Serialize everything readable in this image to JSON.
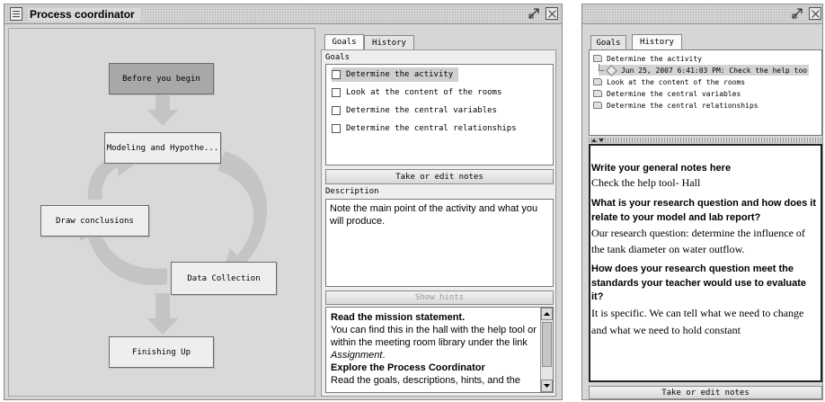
{
  "process_window": {
    "title": "Process coordinator",
    "flow": {
      "before": "Before you begin",
      "modeling": "Modeling and Hypothe...",
      "draw": "Draw conclusions",
      "data": "Data Collection",
      "finishing": "Finishing Up"
    },
    "tabs": {
      "goals": "Goals",
      "history": "History"
    },
    "goals_label": "Goals",
    "goals": [
      "Determine the activity",
      "Look at the content of the rooms",
      "Determine the central variables",
      "Determine the central relationships"
    ],
    "notes_button": "Take or edit notes",
    "description_label": "Description",
    "description_text": "Note the main point of the activity and what you will produce.",
    "hints_button": "Show hints",
    "hints": {
      "h1": "Read the mission statement.",
      "p1a": "You can find this in the hall with the help tool or within the meeting room library under the link ",
      "p1link": "Assignment",
      "p1end": ".",
      "h2": "Explore the Process Coordinator",
      "p2": "Read the goals, descriptions, hints, and the"
    }
  },
  "history_window": {
    "tabs": {
      "goals": "Goals",
      "history": "History"
    },
    "tree": {
      "root": "Determine the activity",
      "child": "Jun 25, 2007 6:41:03 PM: Check the help too",
      "items": [
        "Look at the content of the rooms",
        "Determine the central variables",
        "Determine the central relationships"
      ]
    },
    "notes": {
      "h1": "Write your general notes here",
      "p1": "Check the help tool- Hall",
      "h2": "What is your research question and how does it relate to your model and lab report?",
      "p2": "Our research question: determine the influence of the tank diameter on water outflow.",
      "h3": "How does your research question meet the standards your teacher would use to evaluate it?",
      "p3": "It is specific. We can tell what we need to change and what we need to hold constant"
    },
    "notes_button": "Take or edit notes"
  },
  "colors": {
    "selected_box": "#a8a8a8",
    "arrow": "#c4c4c4"
  }
}
